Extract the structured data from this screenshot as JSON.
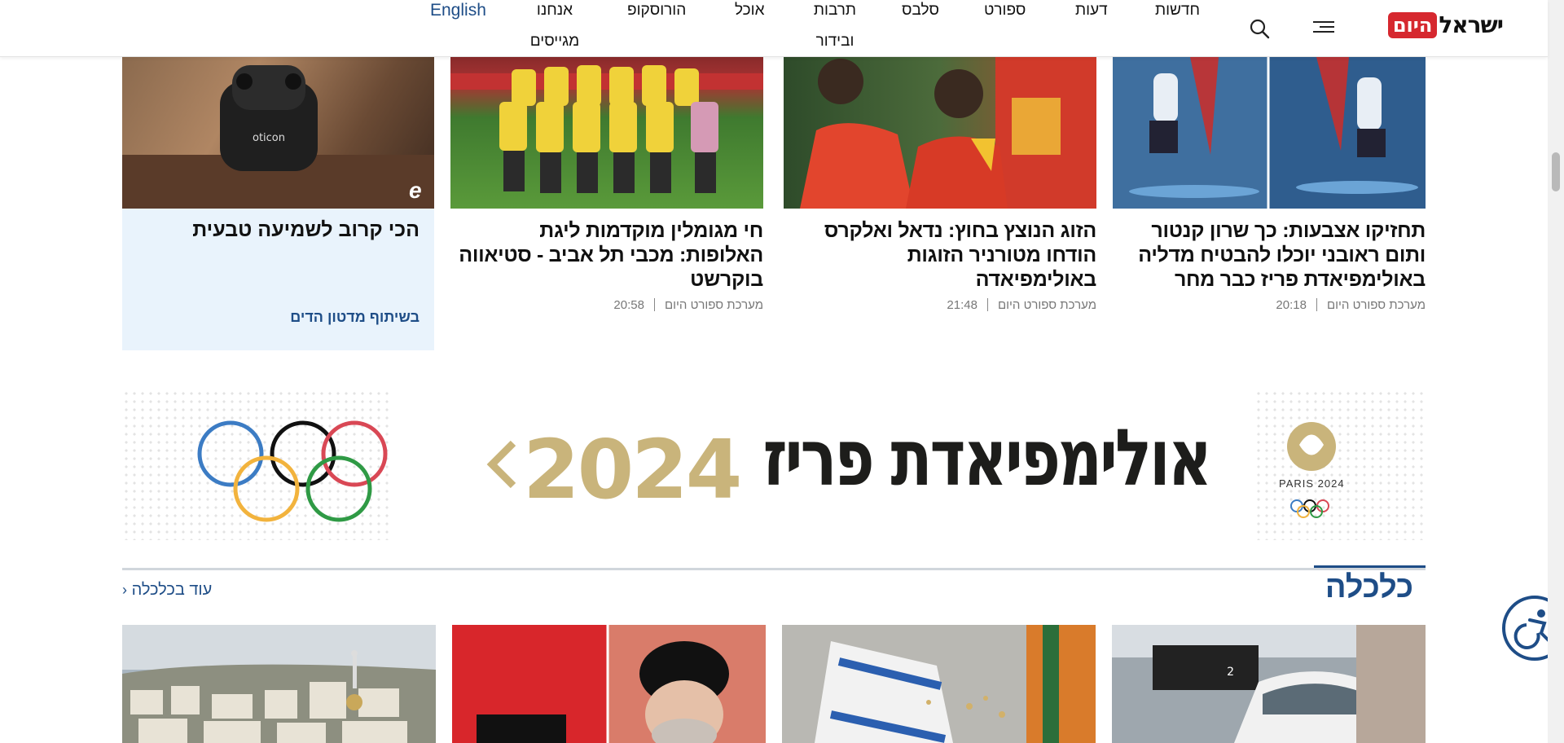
{
  "header": {
    "logo": {
      "main": "ישראל",
      "badge": "היום"
    },
    "nav": [
      "חדשות",
      "דעות",
      "ספורט",
      "סלבס",
      "תרבות ובידור",
      "אוכל",
      "הורוסקופ",
      "אנחנו מגייסים"
    ],
    "english": "English"
  },
  "articles": [
    {
      "title": "תחזיקו אצבעות: כך שרון קנטור ותום ראובני יוכלו להבטיח מדליה באולימפיאדת פריז כבר מחר",
      "author": "מערכת ספורט היום",
      "time": "20:18"
    },
    {
      "title": "הזוג הנוצץ בחוץ: נדאל ואלקרס הודחו מטורניר הזוגות באולימפיאדה",
      "author": "מערכת ספורט היום",
      "time": "21:48"
    },
    {
      "title": "חי מגומלין מוקדמות ליגת האלופות: מכבי תל אביב - סטיאווה בוקרשט",
      "author": "מערכת ספורט היום",
      "time": "20:58"
    }
  ],
  "promo": {
    "title": "הכי קרוב לשמיעה טבעית",
    "partner": "בשיתוף מדטון הדים",
    "product_text": "oticon",
    "badge": "e"
  },
  "banner": {
    "title": "אולימפיאדת פריז",
    "year": "2024",
    "emblem_text": "PARIS 2024"
  },
  "section": {
    "title": "כלכלה",
    "more": "עוד בכלכלה",
    "tram_sign": "2"
  },
  "colors": {
    "brand_red": "#d6282f",
    "link_blue": "#1e4d87",
    "olympic_gold": "#c9b47b",
    "promo_bg": "#e9f3fc"
  }
}
